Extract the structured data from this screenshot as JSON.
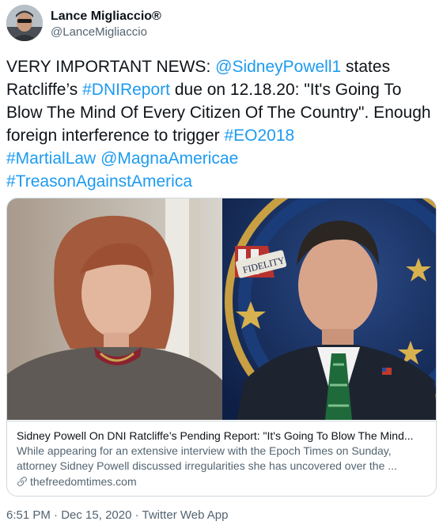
{
  "author": {
    "name": "Lance Migliaccio®",
    "handle": "@LanceMigliaccio",
    "avatar_icon": "user-avatar"
  },
  "tweet": {
    "segments": [
      {
        "text": "VERY IMPORTANT NEWS: ",
        "kind": "text"
      },
      {
        "text": "@SidneyPowell1",
        "kind": "mention"
      },
      {
        "text": " states Ratcliffe’s ",
        "kind": "text"
      },
      {
        "text": "#DNIReport",
        "kind": "hashtag"
      },
      {
        "text": " due on 12.18.20: \"It's Going To Blow The Mind Of Every Citizen Of The Country\". Enough foreign interference to trigger ",
        "kind": "text"
      },
      {
        "text": "#EO2018",
        "kind": "hashtag"
      },
      {
        "text": " ",
        "kind": "text"
      },
      {
        "text": "#MartialLaw",
        "kind": "hashtag"
      },
      {
        "text": " ",
        "kind": "text"
      },
      {
        "text": "@MagnaAmericae",
        "kind": "mention"
      },
      {
        "text": " ",
        "kind": "text"
      },
      {
        "text": "#TreasonAgainstAmerica",
        "kind": "hashtag"
      }
    ]
  },
  "card": {
    "title": "Sidney Powell On DNI Ratcliffe’s Pending Report: \"It's Going To Blow The Mind...",
    "description": "While appearing for an extensive interview with the Epoch Times on Sunday, attorney Sidney Powell discussed irregularities she has uncovered over the ...",
    "domain": "thefreedomtimes.com",
    "link_icon": "link-icon",
    "badge_text": "FIDELITY"
  },
  "footer": {
    "time": "6:51 PM",
    "date": "Dec 15, 2020",
    "source": "Twitter Web App",
    "separator": " · "
  },
  "colors": {
    "link": "#1d9bf0",
    "text": "#0f1419",
    "muted": "#536471",
    "border": "#cfd9de"
  }
}
